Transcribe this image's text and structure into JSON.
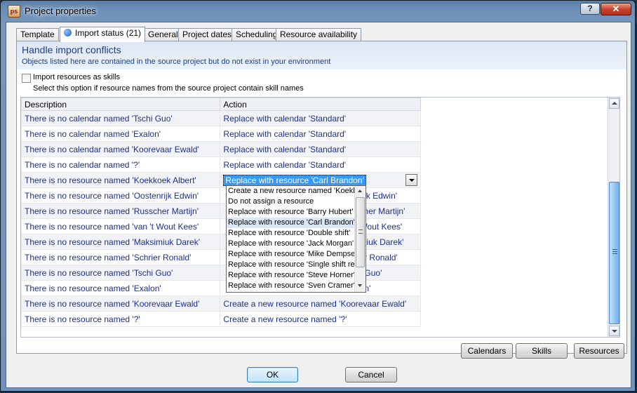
{
  "window": {
    "title": "Project properties",
    "app_icon_text": "ps",
    "help_label": "?",
    "close_label": "✕"
  },
  "tabs": [
    {
      "label": "Template"
    },
    {
      "label": "Import status (21)"
    },
    {
      "label": "General"
    },
    {
      "label": "Project dates"
    },
    {
      "label": "Scheduling"
    },
    {
      "label": "Resource availability"
    }
  ],
  "panel": {
    "heading": "Handle import conflicts",
    "subheading": "Objects listed here are contained in the source project but do not exist in your environment",
    "checkbox_label": "Import resources as skills",
    "checkbox_checked": false,
    "checkbox_hint": "Select this option if resource names from the source project contain skill names"
  },
  "grid": {
    "columns": [
      "Description",
      "Action"
    ],
    "rows": [
      {
        "description": "There is no calendar named 'Tschi  Guo'",
        "action": "Replace with calendar 'Standard'"
      },
      {
        "description": "There is no calendar named 'Exalon'",
        "action": "Replace with calendar 'Standard'"
      },
      {
        "description": "There is no calendar named 'Koorevaar Ewald'",
        "action": "Replace with calendar 'Standard'"
      },
      {
        "description": "There is no calendar named '?'",
        "action": "Replace with calendar 'Standard'"
      },
      {
        "description": "There is no resource named 'Koekkoek  Albert'",
        "action": "Replace with resource 'Carl Brandon'"
      },
      {
        "description": "There is no resource named 'Oostenrijk  Edwin'",
        "action": "rijk  Edwin'"
      },
      {
        "description": "There is no resource named 'Russcher  Martijn'",
        "action": "cher  Martijn'"
      },
      {
        "description": "There is no resource named 'van 't Wout  Kees'",
        "action": "Wout  Kees'"
      },
      {
        "description": "There is no resource named 'Maksimiuk  Darek'",
        "action": "miuk  Darek'"
      },
      {
        "description": "There is no resource named 'Schrier  Ronald'",
        "action": "er  Ronald'"
      },
      {
        "description": "There is no resource named 'Tschi  Guo'",
        "action": "Guo'"
      },
      {
        "description": "There is no resource named 'Exalon'",
        "action": "n'"
      },
      {
        "description": "There is no resource named 'Koorevaar Ewald'",
        "action": "Create a new resource named 'Koorevaar Ewald'"
      },
      {
        "description": "There is no resource named '?'",
        "action": "Create a new resource named '?'"
      }
    ]
  },
  "dropdown": {
    "items": [
      "Create a new resource named 'Koekkoek  Albert'",
      "Do not assign a resource",
      "Replace with resource 'Barry Hubert'",
      "Replace with resource 'Carl Brandon'",
      "Replace with resource 'Double shift'",
      "Replace with resource 'Jack Morgan'",
      "Replace with resource 'Mike Dempsey'",
      "Replace with resource 'Single shift res'",
      "Replace with resource 'Steve Horner'",
      "Replace with resource 'Sven Cramer'"
    ],
    "highlighted_index": 3
  },
  "panel_buttons": {
    "calendars": "Calendars",
    "skills": "Skills",
    "resources": "Resources"
  },
  "dialog_buttons": {
    "ok": "OK",
    "cancel": "Cancel"
  }
}
